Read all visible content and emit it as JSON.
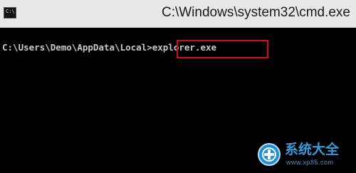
{
  "window": {
    "title": "C:\\Windows\\system32\\cmd.exe",
    "icon": "cmd-icon",
    "icon_glyph": "C:\\"
  },
  "console": {
    "prompt": "C:\\Users\\Demo\\AppData\\Local>",
    "command": "explorer.exe",
    "highlight_color": "#d01010",
    "text_color": "#c8c8c8",
    "background": "#000000"
  },
  "watermark": {
    "title": "系统大全",
    "url": "www.xp85.com",
    "icon": "globe-logo-icon",
    "color": "#3a9ad9"
  }
}
